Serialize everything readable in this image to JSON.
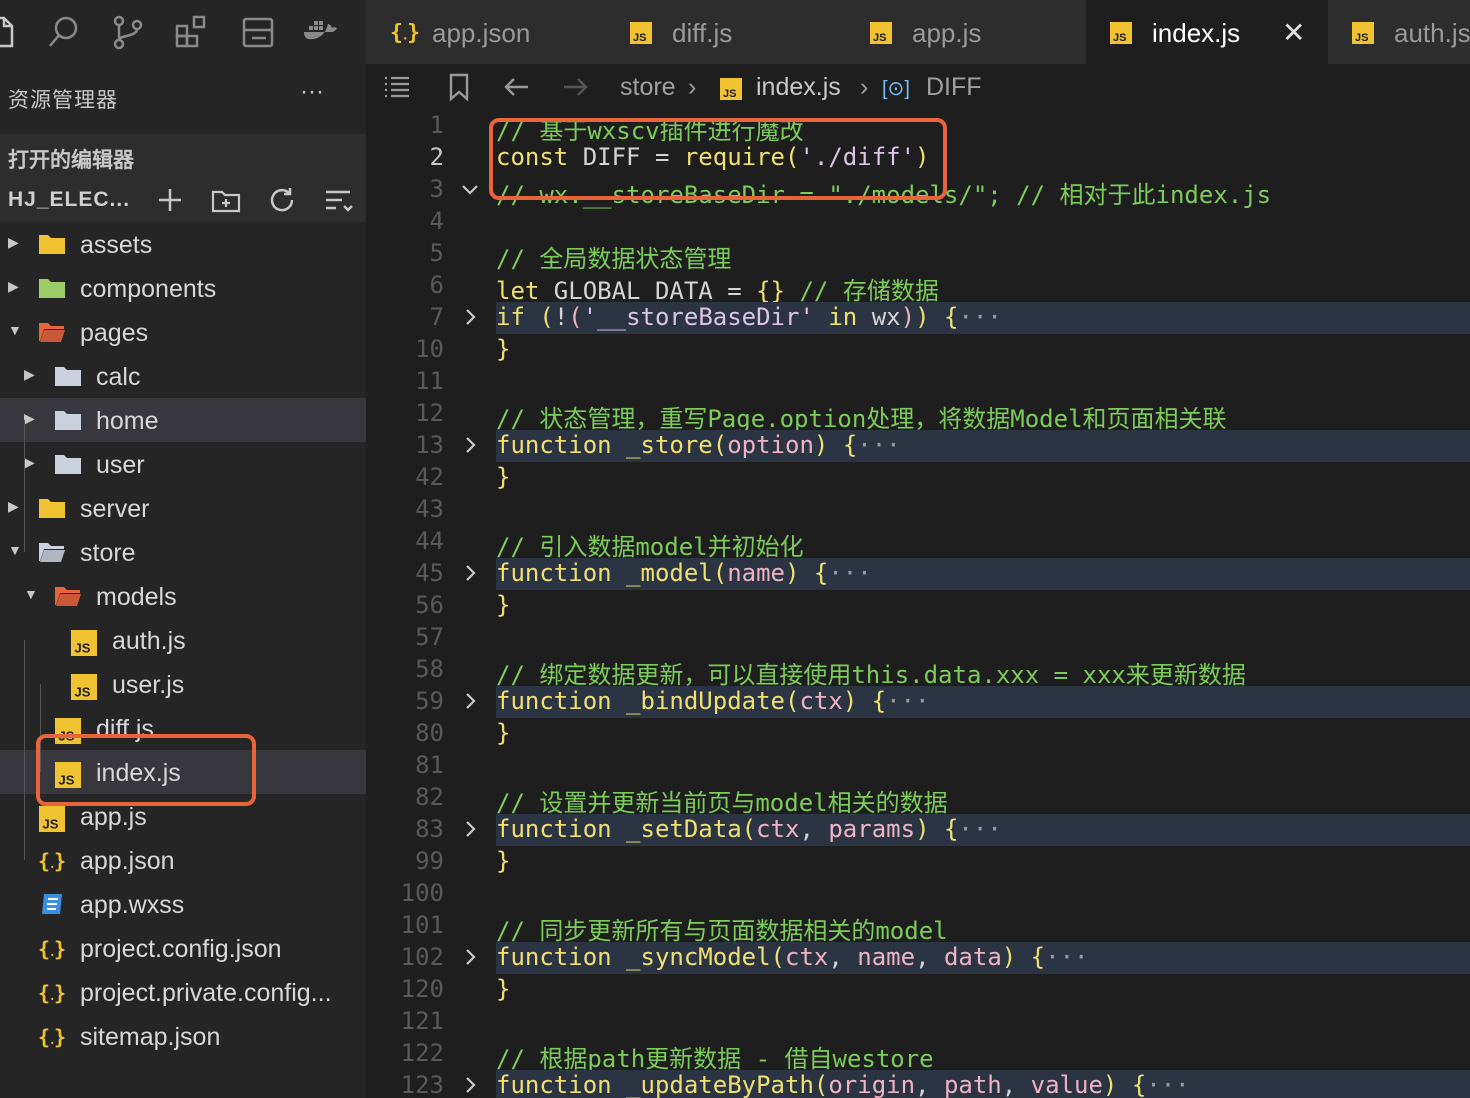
{
  "activity_bar": {
    "icons": [
      "files-icon",
      "search-icon",
      "source-control-icon",
      "extensions-icon",
      "layout-icon",
      "docker-icon"
    ]
  },
  "sidebar": {
    "title": "资源管理器",
    "more": "···",
    "open_editors": "打开的编辑器",
    "project": "HJ_ELEC...",
    "tree": [
      {
        "label": "assets",
        "type": "folder",
        "expanded": false,
        "depth": 0
      },
      {
        "label": "components",
        "type": "folder",
        "expanded": false,
        "depth": 0
      },
      {
        "label": "pages",
        "type": "folder",
        "expanded": true,
        "depth": 0
      },
      {
        "label": "calc",
        "type": "folder",
        "expanded": false,
        "depth": 1
      },
      {
        "label": "home",
        "type": "folder",
        "expanded": false,
        "depth": 1
      },
      {
        "label": "user",
        "type": "folder",
        "expanded": false,
        "depth": 1
      },
      {
        "label": "server",
        "type": "folder",
        "expanded": false,
        "depth": 0
      },
      {
        "label": "store",
        "type": "folder",
        "expanded": true,
        "depth": 0
      },
      {
        "label": "models",
        "type": "folder",
        "expanded": true,
        "depth": 1
      },
      {
        "label": "auth.js",
        "type": "js",
        "depth": 2
      },
      {
        "label": "user.js",
        "type": "js",
        "depth": 2
      },
      {
        "label": "diff.js",
        "type": "js",
        "depth": 1
      },
      {
        "label": "index.js",
        "type": "js",
        "depth": 1
      },
      {
        "label": "app.js",
        "type": "js",
        "depth": 0
      },
      {
        "label": "app.json",
        "type": "json",
        "depth": 0
      },
      {
        "label": "app.wxss",
        "type": "css",
        "depth": 0
      },
      {
        "label": "project.config.json",
        "type": "json",
        "depth": 0
      },
      {
        "label": "project.private.config...",
        "type": "json",
        "depth": 0
      },
      {
        "label": "sitemap.json",
        "type": "json",
        "depth": 0
      }
    ]
  },
  "tabs": [
    {
      "label": "app.json",
      "icon": "json",
      "active": false
    },
    {
      "label": "diff.js",
      "icon": "js",
      "active": false
    },
    {
      "label": "app.js",
      "icon": "js",
      "active": false
    },
    {
      "label": "index.js",
      "icon": "js",
      "active": true,
      "close": "✕"
    },
    {
      "label": "auth.js",
      "icon": "js",
      "active": false
    }
  ],
  "breadcrumb": {
    "folder": "store",
    "file": "index.js",
    "symbol": "DIFF",
    "symbol_icon": "[⊙]"
  },
  "editor": {
    "lines": [
      {
        "n": "1",
        "fold": "",
        "hl": false,
        "tokens": [
          [
            "cm",
            "// 基于wxscv插件进行魔改"
          ]
        ]
      },
      {
        "n": "2",
        "fold": "",
        "hl": false,
        "current": true,
        "tokens": [
          [
            "kw",
            "const"
          ],
          [
            "",
            " DIFF = "
          ],
          [
            "fn",
            "require"
          ],
          [
            "br",
            "("
          ],
          [
            "st",
            "'./diff'"
          ],
          [
            "br",
            ")"
          ]
        ]
      },
      {
        "n": "3",
        "fold": "down",
        "hl": false,
        "tokens": [
          [
            "cm",
            "// wx.__storeBaseDir = \"./models/\"; // 相对于此index.js"
          ]
        ]
      },
      {
        "n": "4",
        "fold": "",
        "hl": false,
        "tokens": []
      },
      {
        "n": "5",
        "fold": "",
        "hl": false,
        "tokens": [
          [
            "cm",
            "// 全局数据状态管理"
          ]
        ]
      },
      {
        "n": "6",
        "fold": "",
        "hl": false,
        "tokens": [
          [
            "kw",
            "let"
          ],
          [
            "",
            " GLOBAL_DATA = "
          ],
          [
            "br",
            "{}"
          ],
          [
            "",
            " "
          ],
          [
            "cm",
            "// 存储数据"
          ]
        ]
      },
      {
        "n": "7",
        "fold": "right",
        "hl": true,
        "tokens": [
          [
            "kw",
            "if"
          ],
          [
            "",
            " "
          ],
          [
            "br",
            "("
          ],
          [
            "",
            "!"
          ],
          [
            "pm",
            "("
          ],
          [
            "st",
            "'__storeBaseDir'"
          ],
          [
            "",
            " "
          ],
          [
            "kw",
            "in"
          ],
          [
            "",
            " wx"
          ],
          [
            "pm",
            ")"
          ],
          [
            "br",
            ")"
          ],
          [
            "",
            " "
          ],
          [
            "br",
            "{"
          ],
          [
            "fold-ell",
            "···"
          ]
        ]
      },
      {
        "n": "10",
        "fold": "",
        "hl": false,
        "tokens": [
          [
            "br",
            "}"
          ]
        ]
      },
      {
        "n": "11",
        "fold": "",
        "hl": false,
        "tokens": []
      },
      {
        "n": "12",
        "fold": "",
        "hl": false,
        "tokens": [
          [
            "cm",
            "// 状态管理，重写Page.option处理，将数据Model和页面相关联"
          ]
        ]
      },
      {
        "n": "13",
        "fold": "right",
        "hl": true,
        "tokens": [
          [
            "kw",
            "function"
          ],
          [
            "",
            " "
          ],
          [
            "fn",
            "_store"
          ],
          [
            "br",
            "("
          ],
          [
            "pm",
            "option"
          ],
          [
            "br",
            ")"
          ],
          [
            "",
            " "
          ],
          [
            "br",
            "{"
          ],
          [
            "fold-ell",
            "···"
          ]
        ]
      },
      {
        "n": "42",
        "fold": "",
        "hl": false,
        "tokens": [
          [
            "br",
            "}"
          ]
        ]
      },
      {
        "n": "43",
        "fold": "",
        "hl": false,
        "tokens": []
      },
      {
        "n": "44",
        "fold": "",
        "hl": false,
        "tokens": [
          [
            "cm",
            "// 引入数据model并初始化"
          ]
        ]
      },
      {
        "n": "45",
        "fold": "right",
        "hl": true,
        "tokens": [
          [
            "kw",
            "function"
          ],
          [
            "",
            " "
          ],
          [
            "fn",
            "_model"
          ],
          [
            "br",
            "("
          ],
          [
            "pm",
            "name"
          ],
          [
            "br",
            ")"
          ],
          [
            "",
            " "
          ],
          [
            "br",
            "{"
          ],
          [
            "fold-ell",
            "···"
          ]
        ]
      },
      {
        "n": "56",
        "fold": "",
        "hl": false,
        "tokens": [
          [
            "br",
            "}"
          ]
        ]
      },
      {
        "n": "57",
        "fold": "",
        "hl": false,
        "tokens": []
      },
      {
        "n": "58",
        "fold": "",
        "hl": false,
        "tokens": [
          [
            "cm",
            "// 绑定数据更新，可以直接使用this.data.xxx = xxx来更新数据"
          ]
        ]
      },
      {
        "n": "59",
        "fold": "right",
        "hl": true,
        "tokens": [
          [
            "kw",
            "function"
          ],
          [
            "",
            " "
          ],
          [
            "fn",
            "_bindUpdate"
          ],
          [
            "br",
            "("
          ],
          [
            "pm",
            "ctx"
          ],
          [
            "br",
            ")"
          ],
          [
            "",
            " "
          ],
          [
            "br",
            "{"
          ],
          [
            "fold-ell",
            "···"
          ]
        ]
      },
      {
        "n": "80",
        "fold": "",
        "hl": false,
        "tokens": [
          [
            "br",
            "}"
          ]
        ]
      },
      {
        "n": "81",
        "fold": "",
        "hl": false,
        "tokens": []
      },
      {
        "n": "82",
        "fold": "",
        "hl": false,
        "tokens": [
          [
            "cm",
            "// 设置并更新当前页与model相关的数据"
          ]
        ]
      },
      {
        "n": "83",
        "fold": "right",
        "hl": true,
        "tokens": [
          [
            "kw",
            "function"
          ],
          [
            "",
            " "
          ],
          [
            "fn",
            "_setData"
          ],
          [
            "br",
            "("
          ],
          [
            "pm",
            "ctx"
          ],
          [
            "",
            ", "
          ],
          [
            "pm",
            "params"
          ],
          [
            "br",
            ")"
          ],
          [
            "",
            " "
          ],
          [
            "br",
            "{"
          ],
          [
            "fold-ell",
            "···"
          ]
        ]
      },
      {
        "n": "99",
        "fold": "",
        "hl": false,
        "tokens": [
          [
            "br",
            "}"
          ]
        ]
      },
      {
        "n": "100",
        "fold": "",
        "hl": false,
        "tokens": []
      },
      {
        "n": "101",
        "fold": "",
        "hl": false,
        "tokens": [
          [
            "cm",
            "// 同步更新所有与页面数据相关的model"
          ]
        ]
      },
      {
        "n": "102",
        "fold": "right",
        "hl": true,
        "tokens": [
          [
            "kw",
            "function"
          ],
          [
            "",
            " "
          ],
          [
            "fn",
            "_syncModel"
          ],
          [
            "br",
            "("
          ],
          [
            "pm",
            "ctx"
          ],
          [
            "",
            ", "
          ],
          [
            "pm",
            "name"
          ],
          [
            "",
            ", "
          ],
          [
            "pm",
            "data"
          ],
          [
            "br",
            ")"
          ],
          [
            "",
            " "
          ],
          [
            "br",
            "{"
          ],
          [
            "fold-ell",
            "···"
          ]
        ]
      },
      {
        "n": "120",
        "fold": "",
        "hl": false,
        "tokens": [
          [
            "br",
            "}"
          ]
        ]
      },
      {
        "n": "121",
        "fold": "",
        "hl": false,
        "tokens": []
      },
      {
        "n": "122",
        "fold": "",
        "hl": false,
        "tokens": [
          [
            "cm",
            "// 根据path更新数据 - 借自westore"
          ]
        ]
      },
      {
        "n": "123",
        "fold": "right",
        "hl": true,
        "tokens": [
          [
            "kw",
            "function"
          ],
          [
            "",
            " "
          ],
          [
            "fn",
            "_updateByPath"
          ],
          [
            "br",
            "("
          ],
          [
            "pm",
            "origin"
          ],
          [
            "",
            ", "
          ],
          [
            "pm",
            "path"
          ],
          [
            "",
            ", "
          ],
          [
            "pm",
            "value"
          ],
          [
            "br",
            ")"
          ],
          [
            "",
            " "
          ],
          [
            "br",
            "{"
          ],
          [
            "fold-ell",
            "···"
          ]
        ]
      }
    ]
  },
  "colors": {
    "callout": "#e8643b",
    "js_badge": "#f1c232",
    "json_braces": "#f1c232",
    "css_icon": "#3a8fe0",
    "folder_generic": "#c8d1dc",
    "folder_assets": "#f1c232",
    "folder_components": "#9ccc65",
    "folder_pages": "#e8643b"
  }
}
